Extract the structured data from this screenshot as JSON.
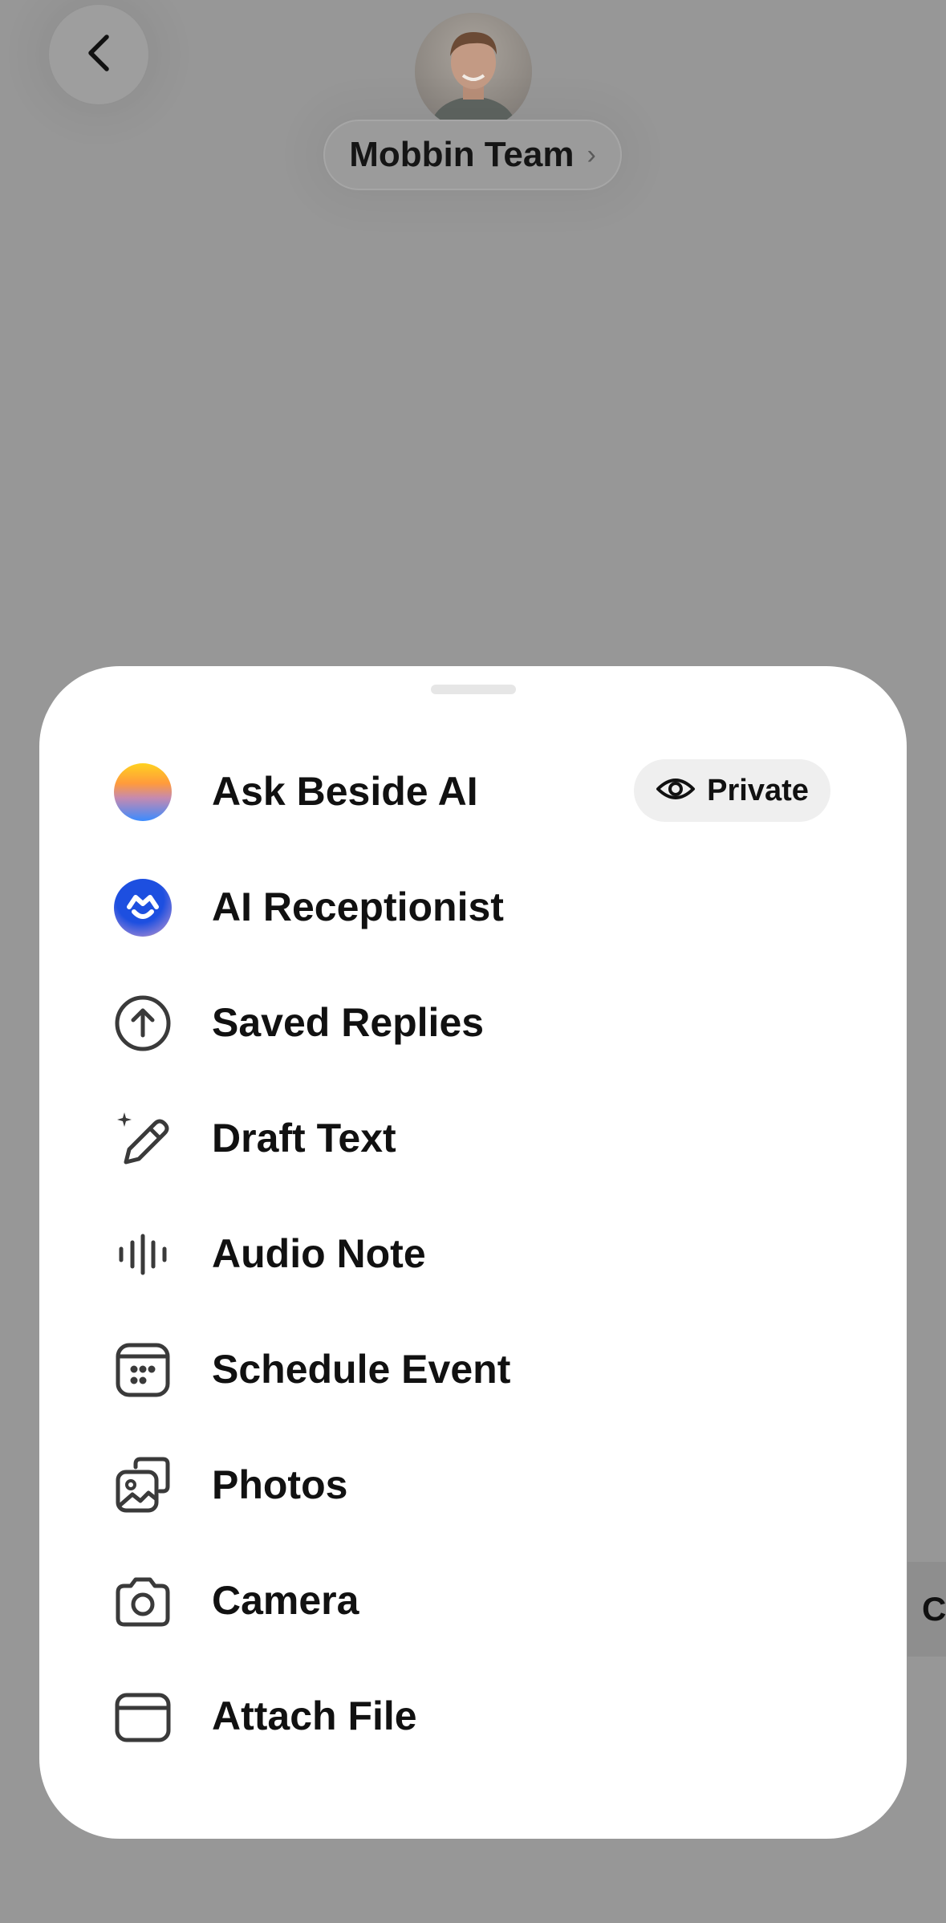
{
  "header": {
    "back_icon": "chevron-left-icon",
    "contact_name": "Mobbin Team",
    "contact_chevron": "›"
  },
  "peek_button_text": "C",
  "sheet": {
    "private_badge": {
      "icon": "eye-icon",
      "label": "Private"
    },
    "items": [
      {
        "label": "Ask Beside AI",
        "icon": "beside-ai-orb-icon"
      },
      {
        "label": "AI Receptionist",
        "icon": "ai-receptionist-icon"
      },
      {
        "label": "Saved Replies",
        "icon": "arrow-up-circle-icon"
      },
      {
        "label": "Draft Text",
        "icon": "sparkle-pencil-icon"
      },
      {
        "label": "Audio Note",
        "icon": "waveform-icon"
      },
      {
        "label": "Schedule Event",
        "icon": "calendar-icon"
      },
      {
        "label": "Photos",
        "icon": "photos-icon"
      },
      {
        "label": "Camera",
        "icon": "camera-icon"
      },
      {
        "label": "Attach File",
        "icon": "folder-icon"
      }
    ]
  },
  "colors": {
    "backdrop": "#979797",
    "sheet": "#ffffff",
    "text": "#111111",
    "icon_stroke": "#3a3a3a",
    "private_badge_bg": "#efefef",
    "receptionist_blue": "#1d4fe0"
  }
}
